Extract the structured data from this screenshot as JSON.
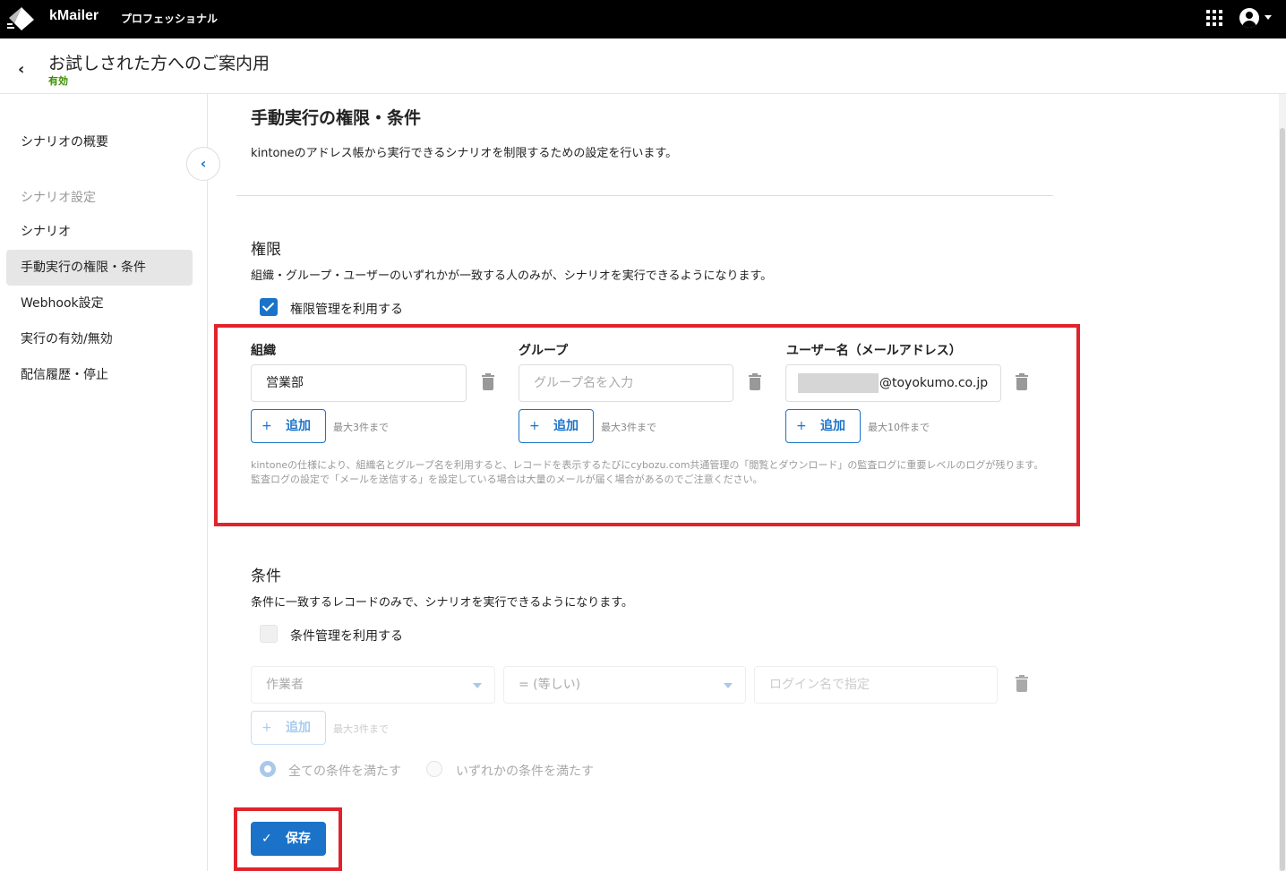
{
  "topbar": {
    "app_name": "kMailer",
    "plan": "プロフェッショナル",
    "icons": [
      "kmailer-logo-icon",
      "apps-grid-icon",
      "account-icon",
      "caret-down-icon"
    ]
  },
  "header": {
    "title": "お試しされた方へのご案内用",
    "status": "有効",
    "status_color": "#3a8f00"
  },
  "sidebar": {
    "items": [
      {
        "label": "シナリオの概要"
      },
      {
        "label": "シナリオ設定"
      },
      {
        "label": "シナリオ"
      },
      {
        "label": "手動実行の権限・条件"
      },
      {
        "label": "Webhook設定"
      },
      {
        "label": "実行の有効/無効"
      },
      {
        "label": "配信履歴・停止"
      }
    ]
  },
  "main": {
    "title": "手動実行の権限・条件",
    "description": "kintoneのアドレス帳から実行できるシナリオを制限するための設定を行います。",
    "permissions": {
      "heading": "権限",
      "description": "組織・グループ・ユーザーのいずれかが一致する人のみが、シナリオを実行できるようになります。",
      "checkbox_label": "権限管理を利用する",
      "checkbox_checked": true,
      "org": {
        "label": "組織",
        "value": "営業部",
        "add_label": "追加",
        "limit": "最大3件まで"
      },
      "group": {
        "label": "グループ",
        "placeholder": "グループ名を入力",
        "add_label": "追加",
        "limit": "最大3件まで"
      },
      "user": {
        "label": "ユーザー名（メールアドレス）",
        "value_suffix": "@toyokumo.co.jp",
        "add_label": "追加",
        "limit": "最大10件まで"
      },
      "note": "kintoneの仕様により、組織名とグループ名を利用すると、レコードを表示するたびにcybozu.com共通管理の「閲覧とダウンロード」の監査ログに重要レベルのログが残ります。監査ログの設定で「メールを送信する」を設定している場合は大量のメールが届く場合があるのでご注意ください。"
    },
    "conditions": {
      "heading": "条件",
      "description": "条件に一致するレコードのみで、シナリオを実行できるようになります。",
      "checkbox_label": "条件管理を利用する",
      "checkbox_checked": false,
      "field_select": "作業者",
      "operator_select": "= (等しい)",
      "value_placeholder": "ログイン名で指定",
      "add_label": "追加",
      "limit": "最大3件まで",
      "radio_all": "全ての条件を満たす",
      "radio_any": "いずれかの条件を満たす",
      "radio_selected": "all"
    },
    "save_label": "保存"
  },
  "colors": {
    "primary": "#1a73c8",
    "highlight": "#e0232c",
    "topbar": "#000000"
  }
}
